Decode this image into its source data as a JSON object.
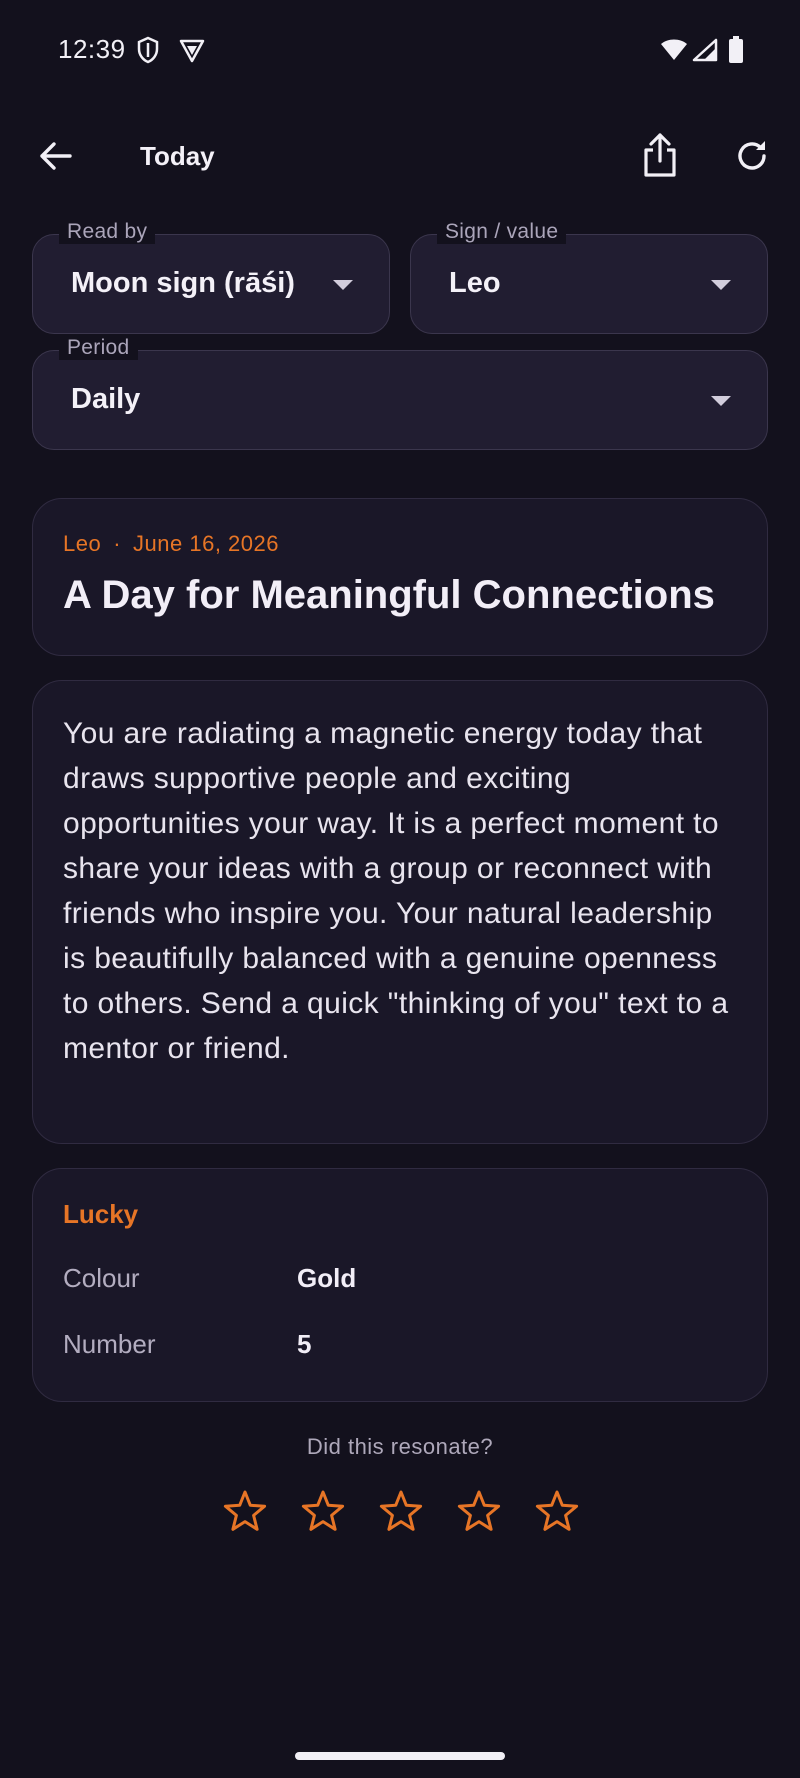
{
  "status_bar": {
    "time": "12:39",
    "left_icons": [
      "shield-icon",
      "vpn-badge-icon"
    ],
    "right_icons": [
      "wifi-icon",
      "signal-icon",
      "battery-icon"
    ]
  },
  "app_bar": {
    "title": "Today",
    "icons": [
      "back-arrow-icon",
      "share-icon",
      "refresh-icon"
    ]
  },
  "filters": {
    "read_by": {
      "label": "Read by",
      "value": "Moon sign (rāśi)"
    },
    "sign": {
      "label": "Sign / value",
      "value": "Leo"
    },
    "period": {
      "label": "Period",
      "value": "Daily"
    }
  },
  "reading": {
    "sign": "Leo",
    "separator": "·",
    "date": "June 16, 2026",
    "headline": "A Day for Meaningful Connections",
    "body": "You are radiating a magnetic energy today that draws supportive people and exciting opportunities your way. It is a perfect moment to share your ideas with a group or reconnect with friends who inspire you. Your natural leadership is beautifully balanced with a genuine openness to others. Send a quick \"thinking of you\" text to a mentor or friend."
  },
  "lucky": {
    "title": "Lucky",
    "rows": [
      {
        "key": "Colour",
        "value": "Gold"
      },
      {
        "key": "Number",
        "value": "5"
      }
    ]
  },
  "feedback": {
    "prompt": "Did this resonate?",
    "max_stars": 5,
    "rating": 0
  },
  "colors": {
    "background": "#13111d",
    "accent": "#e77526",
    "card": "#1a1728",
    "field": "#211d31"
  }
}
